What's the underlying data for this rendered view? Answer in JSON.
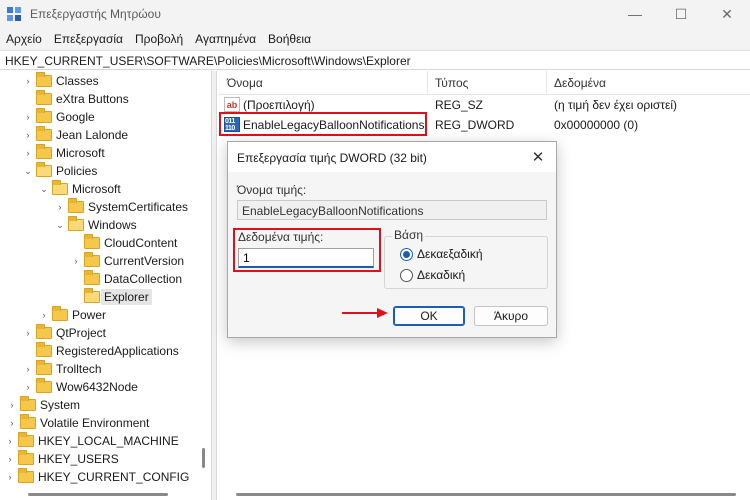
{
  "window": {
    "title": "Επεξεργαστής Μητρώου",
    "minimize_glyph": "—",
    "maximize_glyph": "☐",
    "close_glyph": "✕"
  },
  "menu": [
    "Αρχείο",
    "Επεξεργασία",
    "Προβολή",
    "Αγαπημένα",
    "Βοήθεια"
  ],
  "address": "HKEY_CURRENT_USER\\SOFTWARE\\Policies\\Microsoft\\Windows\\Explorer",
  "tree": [
    {
      "label": "Classes",
      "level": 2,
      "chevron": "›",
      "open": false,
      "selected": false
    },
    {
      "label": "eXtra Buttons",
      "level": 2,
      "chevron": "",
      "open": false,
      "selected": false
    },
    {
      "label": "Google",
      "level": 2,
      "chevron": "›",
      "open": false,
      "selected": false
    },
    {
      "label": "Jean Lalonde",
      "level": 2,
      "chevron": "›",
      "open": false,
      "selected": false
    },
    {
      "label": "Microsoft",
      "level": 2,
      "chevron": "›",
      "open": false,
      "selected": false
    },
    {
      "label": "Policies",
      "level": 2,
      "chevron": "⌄",
      "open": true,
      "selected": false
    },
    {
      "label": "Microsoft",
      "level": 3,
      "chevron": "⌄",
      "open": true,
      "selected": false
    },
    {
      "label": "SystemCertificates",
      "level": 4,
      "chevron": "›",
      "open": false,
      "selected": false
    },
    {
      "label": "Windows",
      "level": 4,
      "chevron": "⌄",
      "open": true,
      "selected": false
    },
    {
      "label": "CloudContent",
      "level": 5,
      "chevron": "",
      "open": false,
      "selected": false
    },
    {
      "label": "CurrentVersion",
      "level": 5,
      "chevron": "›",
      "open": false,
      "selected": false
    },
    {
      "label": "DataCollection",
      "level": 5,
      "chevron": "",
      "open": false,
      "selected": false
    },
    {
      "label": "Explorer",
      "level": 5,
      "chevron": "",
      "open": true,
      "selected": true
    },
    {
      "label": "Power",
      "level": 3,
      "chevron": "›",
      "open": false,
      "selected": false
    },
    {
      "label": "QtProject",
      "level": 2,
      "chevron": "›",
      "open": false,
      "selected": false
    },
    {
      "label": "RegisteredApplications",
      "level": 2,
      "chevron": "",
      "open": false,
      "selected": false
    },
    {
      "label": "Trolltech",
      "level": 2,
      "chevron": "›",
      "open": false,
      "selected": false
    },
    {
      "label": "Wow6432Node",
      "level": 2,
      "chevron": "›",
      "open": false,
      "selected": false
    },
    {
      "label": "System",
      "level": 1,
      "chevron": "›",
      "open": false,
      "selected": false
    },
    {
      "label": "Volatile Environment",
      "level": 1,
      "chevron": "›",
      "open": false,
      "selected": false
    },
    {
      "label": "HKEY_LOCAL_MACHINE",
      "level": 0,
      "chevron": "›",
      "open": false,
      "selected": false
    },
    {
      "label": "HKEY_USERS",
      "level": 0,
      "chevron": "›",
      "open": false,
      "selected": false
    },
    {
      "label": "HKEY_CURRENT_CONFIG",
      "level": 0,
      "chevron": "›",
      "open": false,
      "selected": false
    }
  ],
  "list": {
    "columns": [
      "Όνομα",
      "Τύπος",
      "Δεδομένα"
    ],
    "rows": [
      {
        "icon": "string-value-icon",
        "icon_text": "ab",
        "name": "(Προεπιλογή)",
        "type": "REG_SZ",
        "data": "(η τιμή δεν έχει οριστεί)"
      },
      {
        "icon": "binary-value-icon",
        "icon_text": "011 110",
        "name": "EnableLegacyBalloonNotifications",
        "type": "REG_DWORD",
        "data": "0x00000000 (0)"
      }
    ]
  },
  "dialog": {
    "title": "Επεξεργασία τιμής DWORD (32 bit)",
    "close_glyph": "✕",
    "name_label": "Όνομα τιμής:",
    "name_value": "EnableLegacyBalloonNotifications",
    "data_label": "Δεδομένα τιμής:",
    "data_value": "1",
    "base_label": "Βάση",
    "base_options": [
      {
        "label": "Δεκαεξαδική",
        "selected": true
      },
      {
        "label": "Δεκαδική",
        "selected": false
      }
    ],
    "ok_label": "OK",
    "cancel_label": "Άκυρο"
  },
  "colors": {
    "highlight_red": "#e0101b",
    "accent_blue": "#1a5fb4",
    "folder_yellow": "#f5c84c"
  }
}
